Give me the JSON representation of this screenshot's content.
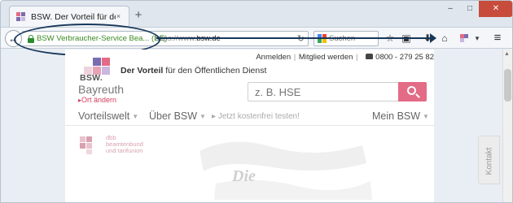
{
  "browser": {
    "tab_title": "BSW. Der Vorteil für den Öff...",
    "tab_close": "×",
    "new_tab": "+",
    "window_controls": {
      "minimize": "–",
      "maximize": "□",
      "close": "✕"
    },
    "back": "←",
    "identity_label": "BSW Verbraucher-Service Bea... (DE)",
    "url_prefix": "https://www.",
    "url_domain": "bsw.de",
    "reload": "↻",
    "search_placeholder": "Suchen",
    "toolbar_icons": [
      "star-icon",
      "clipboard-icon",
      "download-icon",
      "home-icon",
      "addon-icon",
      "menu-icon"
    ],
    "toolbar_glyphs": {
      "star": "☆",
      "clipboard": "▣",
      "download": "⬇",
      "home": "⌂",
      "menu": "≡",
      "more": "▾"
    }
  },
  "annotation": {
    "color": "#16375a"
  },
  "site": {
    "top_links": {
      "login": "Anmelden",
      "separator": "|",
      "register": "Mitglied werden",
      "separator2": "|",
      "phone": "0800 - 279 25 82"
    },
    "logo_text": "BSW.",
    "tagline_bold": "Der Vorteil",
    "tagline_rest": " für den Öffentlichen Dienst",
    "city": "Bayreuth",
    "change_city": "Ort ändern",
    "search_placeholder": "z. B. HSE",
    "nav": {
      "vorteilswelt": "Vorteilswelt",
      "ueber": "Über BSW",
      "free_test": "Jetzt kostenfrei testen!",
      "mein": "Mein BSW"
    },
    "dbb_lines": [
      "dbb",
      "beamtenbund",
      "und tarifunion"
    ],
    "hero_word": "Die",
    "contact_tab": "Kontakt",
    "colors": {
      "accent": "#e36b86",
      "logo_purple": "#7b6cb0",
      "logo_pink": "#e36b86"
    }
  }
}
